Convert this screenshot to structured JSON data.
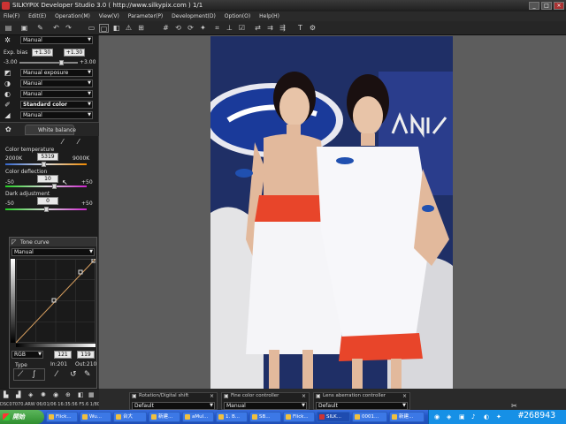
{
  "window": {
    "title": "SILKYPIX Developer Studio 3.0 ( http://www.silkypix.com )   1/1"
  },
  "menu": [
    "File(F)",
    "Edit(E)",
    "Operation(M)",
    "View(V)",
    "Parameter(P)",
    "Development(D)",
    "Option(O)",
    "Help(H)"
  ],
  "left_panel": {
    "taste_select": "Manual",
    "exp_bias": {
      "label": "Exp. bias",
      "value1": "+1.30",
      "value2": "+1.30",
      "min": "-3.00",
      "max": "+3.00",
      "level_fraction": 0.72
    },
    "manual_exposure": "Manual exposure",
    "select_a": "Manual",
    "select_b": "Manual",
    "color_select": "Standard color",
    "select_c": "Manual",
    "white_balance": {
      "label": "White balance"
    },
    "color_temp": {
      "label": "Color temperature",
      "min": "2000K",
      "value": "5319",
      "max": "9000K",
      "level_fraction": 0.47
    },
    "color_deflection": {
      "label": "Color deflection",
      "min": "-50",
      "value": "10",
      "max": "+50",
      "level_fraction": 0.6
    },
    "dark_adjustment": {
      "label": "Dark adjustment",
      "min": "-50",
      "value": "0",
      "max": "+50",
      "level_fraction": 0.5
    }
  },
  "tone_curve": {
    "title": "Tone curve",
    "preset": "Manual",
    "channel": "RGB",
    "in_value": "121",
    "out_value": "119",
    "type_label": "Type",
    "in_label": "In:201",
    "out_label": "Out:210"
  },
  "bottom_panels": [
    {
      "title": "Rotation/Digital shift",
      "value": "Default"
    },
    {
      "title": "Fine color controller",
      "value": "Manual"
    },
    {
      "title": "Lens aberration controller",
      "value": "Default"
    }
  ],
  "status_bar": "DSC07070.ARW 06/01/06 16:35:56 F5.6 1/80 ISO400 -0.3EV 50.0mm",
  "taskbar": {
    "start": "開始",
    "tasks": [
      "Flick...",
      "Wu...",
      "台大",
      "新建...",
      "aMul...",
      "1. B...",
      "SB...",
      "Flick...",
      "SILK...",
      "0001...",
      "新建..."
    ]
  },
  "watermark": "#268943",
  "colors": {
    "titlebar": "#2a2a2a",
    "viewer_bg": "#5d5d5d",
    "taskbar": "#2456c8",
    "start": "#2f8f2f"
  }
}
